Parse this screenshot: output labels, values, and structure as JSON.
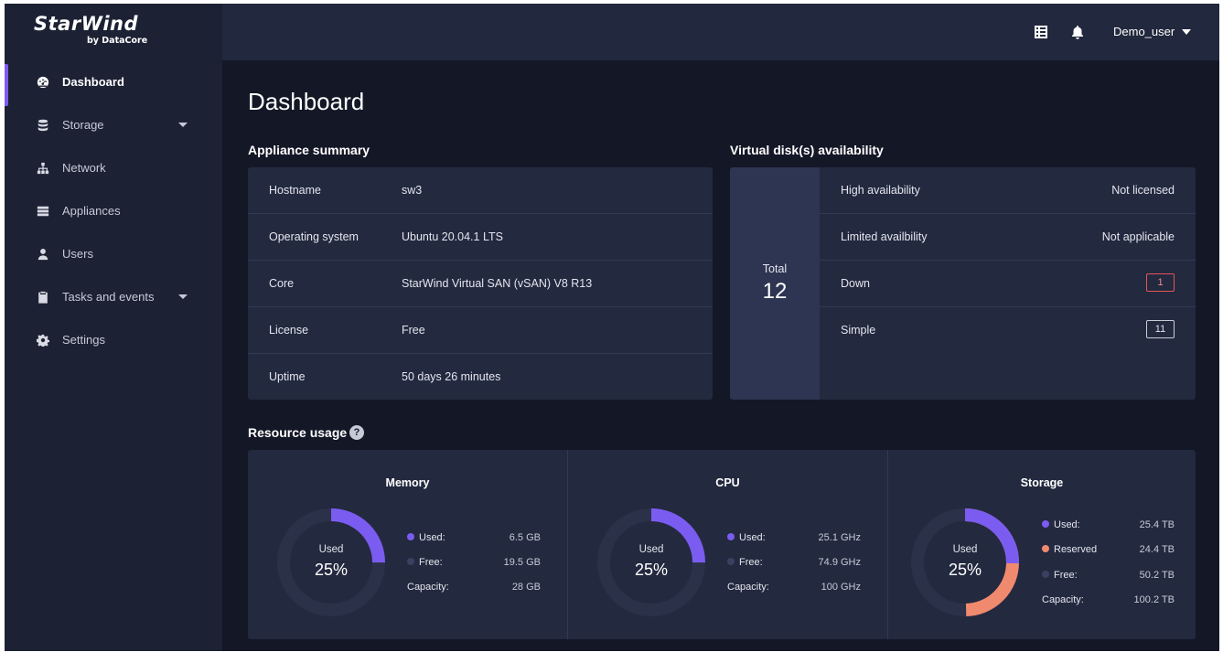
{
  "brand": {
    "name": "StarWind",
    "sub": "by DataCore"
  },
  "sidebar": {
    "items": [
      {
        "label": "Dashboard",
        "icon": "dashboard-icon",
        "active": true
      },
      {
        "label": "Storage",
        "icon": "database-icon",
        "has_caret": true
      },
      {
        "label": "Network",
        "icon": "network-icon"
      },
      {
        "label": "Appliances",
        "icon": "server-icon"
      },
      {
        "label": "Users",
        "icon": "user-icon"
      },
      {
        "label": "Tasks and events",
        "icon": "clipboard-icon",
        "has_caret": true
      },
      {
        "label": "Settings",
        "icon": "gear-icon"
      }
    ]
  },
  "header": {
    "user": "Demo_user",
    "icons": [
      "list-icon",
      "bell-icon"
    ]
  },
  "page": {
    "title": "Dashboard"
  },
  "summary": {
    "title": "Appliance summary",
    "rows": [
      {
        "key": "Hostname",
        "value": "sw3"
      },
      {
        "key": "Operating system",
        "value": "Ubuntu 20.04.1 LTS"
      },
      {
        "key": "Core",
        "value": "StarWind Virtual SAN (vSAN) V8 R13"
      },
      {
        "key": "License",
        "value": "Free"
      },
      {
        "key": "Uptime",
        "value": "50 days 26 minutes"
      }
    ]
  },
  "vdisk": {
    "title": "Virtual disk(s) availability",
    "total_label": "Total",
    "total": "12",
    "rows": [
      {
        "key": "High availability",
        "value": "Not licensed"
      },
      {
        "key": "Limited availbility",
        "value": "Not applicable"
      },
      {
        "key": "Down",
        "badge": "1",
        "badge_color": "#e45656"
      },
      {
        "key": "Simple",
        "badge": "11"
      }
    ]
  },
  "resource": {
    "title": "Resource usage",
    "help": "?",
    "colors": {
      "used": "#7b5cf0",
      "reserved": "#f08a6e",
      "free": "#3a4160",
      "track": "#2b3148"
    },
    "panels": [
      {
        "title": "Memory",
        "center_label": "Used",
        "center_value": "25%",
        "used_fraction": 0.25,
        "legend": [
          {
            "label": "Used:",
            "value": "6.5 GB",
            "dot": "used"
          },
          {
            "label": "Free:",
            "value": "19.5 GB",
            "dot": "free"
          },
          {
            "label": "Capacity:",
            "value": "28 GB"
          }
        ]
      },
      {
        "title": "CPU",
        "center_label": "Used",
        "center_value": "25%",
        "used_fraction": 0.25,
        "legend": [
          {
            "label": "Used:",
            "value": "25.1 GHz",
            "dot": "used"
          },
          {
            "label": "Free:",
            "value": "74.9 GHz",
            "dot": "free"
          },
          {
            "label": "Capacity:",
            "value": "100 GHz"
          }
        ]
      },
      {
        "title": "Storage",
        "center_label": "Used",
        "center_value": "25%",
        "used_fraction": 0.253,
        "reserved_fraction": 0.243,
        "legend": [
          {
            "label": "Used:",
            "value": "25.4 TB",
            "dot": "used"
          },
          {
            "label": "Reserved",
            "value": "24.4 TB",
            "dot": "reserved"
          },
          {
            "label": "Free:",
            "value": "50.2 TB",
            "dot": "free"
          },
          {
            "label": "Capacity:",
            "value": "100.2 TB"
          }
        ]
      }
    ]
  }
}
